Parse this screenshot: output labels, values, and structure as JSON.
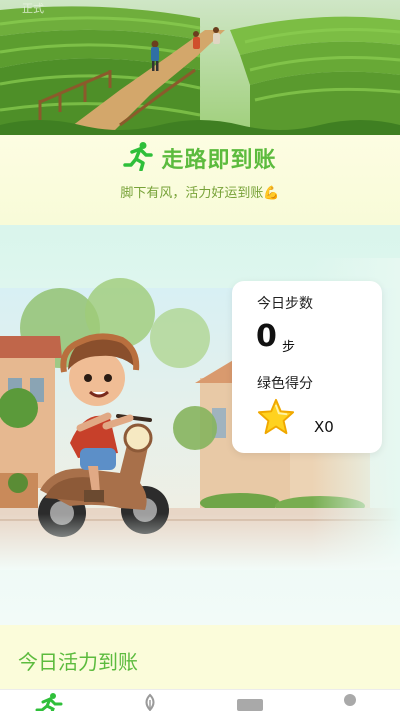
{
  "hero": {
    "tag": "正式"
  },
  "header": {
    "title": "走路即到账",
    "subtitle": "脚下有风，活力好运到账💪"
  },
  "stats_card": {
    "steps_label": "今日步数",
    "steps_value": "0",
    "steps_unit": "步",
    "score_label": "绿色得分",
    "score_count": "X0"
  },
  "vitality": {
    "title": "今日活力到账"
  },
  "nav": {
    "items": [
      {
        "icon": "walking-icon",
        "active": true
      },
      {
        "icon": "leaf-icon",
        "active": false
      },
      {
        "icon": "card-icon",
        "active": false
      },
      {
        "icon": "profile-icon",
        "active": false
      }
    ]
  },
  "colors": {
    "accent_green": "#5cbb3e",
    "subtitle_green": "#77a238",
    "band_mint": "#d9f5ec",
    "section_yellow": "#fbfcda"
  }
}
